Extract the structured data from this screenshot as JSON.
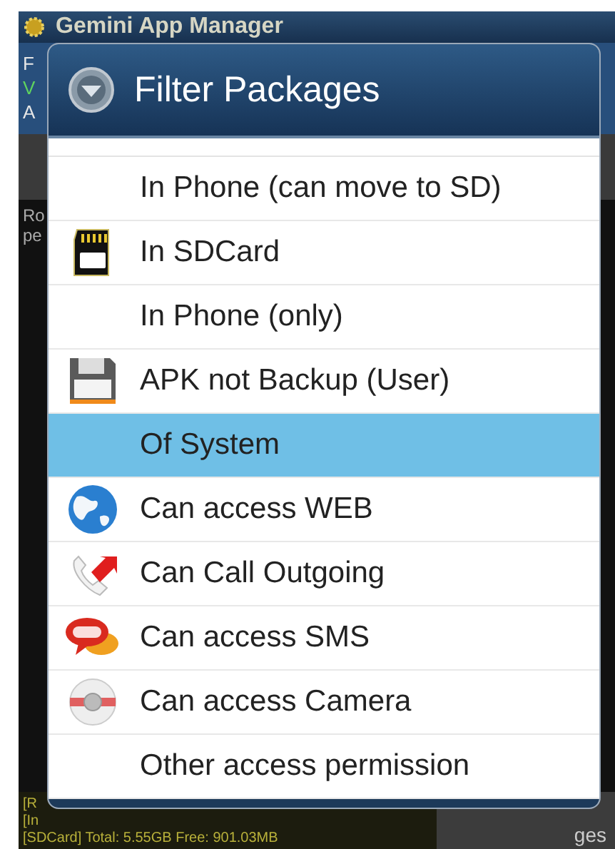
{
  "app": {
    "title": "Gemini App Manager",
    "panel_lines": [
      {
        "text": "F",
        "kind": "normal"
      },
      {
        "text": "V",
        "kind": "ok"
      },
      {
        "text": "A",
        "kind": "normal"
      }
    ],
    "list_lines": [
      "Ro",
      "pe"
    ],
    "status_lines": [
      "[R",
      "[In",
      "[SDCard] Total: 5.55GB Free: 901.03MB"
    ],
    "side_label": "ges"
  },
  "dialog": {
    "title": "Filter Packages",
    "items": [
      {
        "label": "In Phone (can move to SD)",
        "kind": "plain",
        "selected": false
      },
      {
        "label": "In SDCard",
        "kind": "sdcard",
        "selected": false
      },
      {
        "label": "In Phone (only)",
        "kind": "plain",
        "selected": false
      },
      {
        "label": "APK not Backup (User)",
        "kind": "floppy",
        "selected": false
      },
      {
        "label": "Of System",
        "kind": "plain",
        "selected": true
      },
      {
        "label": "Can access WEB",
        "kind": "globe",
        "selected": false
      },
      {
        "label": "Can Call Outgoing",
        "kind": "call",
        "selected": false
      },
      {
        "label": "Can access SMS",
        "kind": "sms",
        "selected": false
      },
      {
        "label": "Can access Camera",
        "kind": "camera",
        "selected": false
      },
      {
        "label": "Other access permission",
        "kind": "plain",
        "selected": false
      }
    ]
  }
}
